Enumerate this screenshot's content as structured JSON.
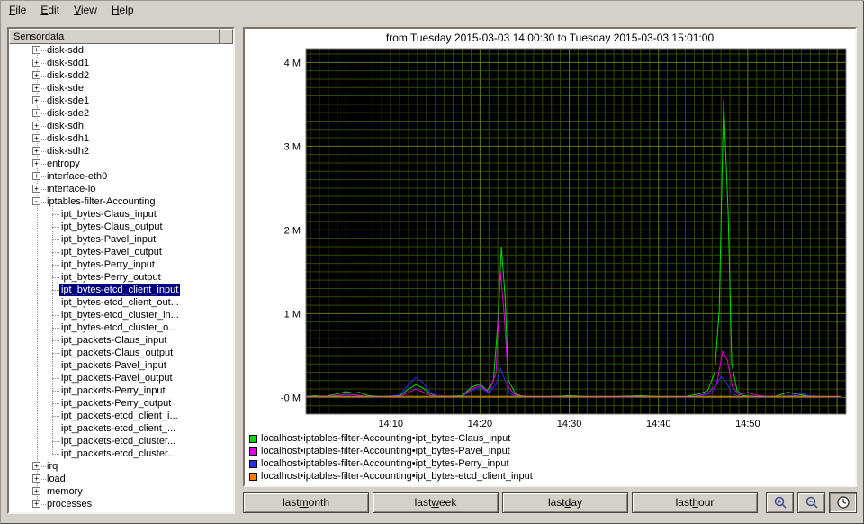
{
  "window": {
    "bg": "#d5d1c8"
  },
  "menu": {
    "items": [
      {
        "id": "file",
        "label": "File",
        "mnemonic": "F"
      },
      {
        "id": "edit",
        "label": "Edit",
        "mnemonic": "E"
      },
      {
        "id": "view",
        "label": "View",
        "mnemonic": "V"
      },
      {
        "id": "help",
        "label": "Help",
        "mnemonic": "H"
      }
    ]
  },
  "sidebar": {
    "header": "Sensordata",
    "items": [
      {
        "label": "disk-sdd",
        "level": 0,
        "expander": "plus",
        "selected": false
      },
      {
        "label": "disk-sdd1",
        "level": 0,
        "expander": "plus",
        "selected": false
      },
      {
        "label": "disk-sdd2",
        "level": 0,
        "expander": "plus",
        "selected": false
      },
      {
        "label": "disk-sde",
        "level": 0,
        "expander": "plus",
        "selected": false
      },
      {
        "label": "disk-sde1",
        "level": 0,
        "expander": "plus",
        "selected": false
      },
      {
        "label": "disk-sde2",
        "level": 0,
        "expander": "plus",
        "selected": false
      },
      {
        "label": "disk-sdh",
        "level": 0,
        "expander": "plus",
        "selected": false
      },
      {
        "label": "disk-sdh1",
        "level": 0,
        "expander": "plus",
        "selected": false
      },
      {
        "label": "disk-sdh2",
        "level": 0,
        "expander": "plus",
        "selected": false
      },
      {
        "label": "entropy",
        "level": 0,
        "expander": "plus",
        "selected": false
      },
      {
        "label": "interface-eth0",
        "level": 0,
        "expander": "plus",
        "selected": false
      },
      {
        "label": "interface-lo",
        "level": 0,
        "expander": "plus",
        "selected": false
      },
      {
        "label": "iptables-filter-Accounting",
        "level": 0,
        "expander": "minus",
        "selected": false
      },
      {
        "label": "ipt_bytes-Claus_input",
        "level": 1,
        "expander": null,
        "selected": false
      },
      {
        "label": "ipt_bytes-Claus_output",
        "level": 1,
        "expander": null,
        "selected": false
      },
      {
        "label": "ipt_bytes-Pavel_input",
        "level": 1,
        "expander": null,
        "selected": false
      },
      {
        "label": "ipt_bytes-Pavel_output",
        "level": 1,
        "expander": null,
        "selected": false
      },
      {
        "label": "ipt_bytes-Perry_input",
        "level": 1,
        "expander": null,
        "selected": false
      },
      {
        "label": "ipt_bytes-Perry_output",
        "level": 1,
        "expander": null,
        "selected": false
      },
      {
        "label": "ipt_bytes-etcd_client_input",
        "level": 1,
        "expander": null,
        "selected": true
      },
      {
        "label": "ipt_bytes-etcd_client_out...",
        "level": 1,
        "expander": null,
        "selected": false
      },
      {
        "label": "ipt_bytes-etcd_cluster_in...",
        "level": 1,
        "expander": null,
        "selected": false
      },
      {
        "label": "ipt_bytes-etcd_cluster_o...",
        "level": 1,
        "expander": null,
        "selected": false
      },
      {
        "label": "ipt_packets-Claus_input",
        "level": 1,
        "expander": null,
        "selected": false
      },
      {
        "label": "ipt_packets-Claus_output",
        "level": 1,
        "expander": null,
        "selected": false
      },
      {
        "label": "ipt_packets-Pavel_input",
        "level": 1,
        "expander": null,
        "selected": false
      },
      {
        "label": "ipt_packets-Pavel_output",
        "level": 1,
        "expander": null,
        "selected": false
      },
      {
        "label": "ipt_packets-Perry_input",
        "level": 1,
        "expander": null,
        "selected": false
      },
      {
        "label": "ipt_packets-Perry_output",
        "level": 1,
        "expander": null,
        "selected": false
      },
      {
        "label": "ipt_packets-etcd_client_i...",
        "level": 1,
        "expander": null,
        "selected": false
      },
      {
        "label": "ipt_packets-etcd_client_...",
        "level": 1,
        "expander": null,
        "selected": false
      },
      {
        "label": "ipt_packets-etcd_cluster...",
        "level": 1,
        "expander": null,
        "selected": false
      },
      {
        "label": "ipt_packets-etcd_cluster...",
        "level": 1,
        "expander": null,
        "selected": false
      },
      {
        "label": "irq",
        "level": 0,
        "expander": "plus",
        "selected": false
      },
      {
        "label": "load",
        "level": 0,
        "expander": "plus",
        "selected": false
      },
      {
        "label": "memory",
        "level": 0,
        "expander": "plus",
        "selected": false
      },
      {
        "label": "processes",
        "level": 0,
        "expander": "plus",
        "selected": false
      }
    ]
  },
  "chart_data": {
    "type": "line",
    "title": "from Tuesday 2015-03-03 14:00:30 to Tuesday 2015-03-03 15:01:00",
    "xlabel": "",
    "ylabel": "",
    "x_unit": "minutes after 14:00",
    "xlim": [
      0.5,
      61
    ],
    "ylim": [
      -0.2,
      4.165
    ],
    "x_ticks": [
      {
        "value": 10,
        "label": "14:10"
      },
      {
        "value": 20,
        "label": "14:20"
      },
      {
        "value": 30,
        "label": "14:30"
      },
      {
        "value": 40,
        "label": "14:40"
      },
      {
        "value": 50,
        "label": "14:50"
      }
    ],
    "y_ticks": [
      {
        "value": 4,
        "label": "4 M"
      },
      {
        "value": 3,
        "label": "3 M"
      },
      {
        "value": 2,
        "label": "2 M"
      },
      {
        "value": 1,
        "label": "1 M"
      },
      {
        "value": 0,
        "label": "-0 M"
      }
    ],
    "grid": {
      "background": "#000000",
      "minor_color": "#314a00",
      "major_color": "#5d7a16",
      "frame_color": "#7d7d7d",
      "minor_x_step": 1,
      "major_x_step": 10,
      "minor_y_step": 0.1,
      "major_y_step": 1
    },
    "legend_position": "bottom-left",
    "series": [
      {
        "name": "localhost•iptables-filter-Accounting•ipt_bytes-Claus_input",
        "color": "#00dc00",
        "points": [
          [
            0.5,
            0.01
          ],
          [
            1.5,
            0.02
          ],
          [
            2.5,
            0.01
          ],
          [
            4,
            0.04
          ],
          [
            5,
            0.07
          ],
          [
            5.8,
            0.05
          ],
          [
            6.5,
            0.06
          ],
          [
            7.5,
            0.02
          ],
          [
            9,
            0.01
          ],
          [
            11,
            0.02
          ],
          [
            12,
            0.1
          ],
          [
            12.8,
            0.15
          ],
          [
            13.5,
            0.12
          ],
          [
            14.5,
            0.04
          ],
          [
            15.5,
            0.01
          ],
          [
            18,
            0.02
          ],
          [
            19,
            0.12
          ],
          [
            20,
            0.16
          ],
          [
            20.8,
            0.08
          ],
          [
            21.5,
            0.2
          ],
          [
            22,
            0.9
          ],
          [
            22.4,
            1.8
          ],
          [
            22.8,
            1.2
          ],
          [
            23.2,
            0.2
          ],
          [
            24,
            0.04
          ],
          [
            25,
            0.01
          ],
          [
            28,
            0.01
          ],
          [
            30,
            0.02
          ],
          [
            32,
            0.01
          ],
          [
            35,
            0.01
          ],
          [
            38,
            0.02
          ],
          [
            40,
            0.01
          ],
          [
            43,
            0.01
          ],
          [
            44.5,
            0.04
          ],
          [
            45.5,
            0.08
          ],
          [
            46.3,
            0.3
          ],
          [
            46.8,
            1.05
          ],
          [
            47.3,
            3.55
          ],
          [
            47.8,
            2.2
          ],
          [
            48.2,
            0.4
          ],
          [
            48.8,
            0.08
          ],
          [
            49.5,
            0.02
          ],
          [
            51,
            0.01
          ],
          [
            53,
            0.01
          ],
          [
            54.5,
            0.06
          ],
          [
            55.5,
            0.04
          ],
          [
            56.5,
            0.02
          ],
          [
            58,
            0.01
          ],
          [
            60.5,
            0.01
          ]
        ]
      },
      {
        "name": "localhost•iptables-filter-Accounting•ipt_bytes-Pavel_input",
        "color": "#dc00dc",
        "points": [
          [
            0.5,
            0.005
          ],
          [
            4,
            0.02
          ],
          [
            5,
            0.04
          ],
          [
            6,
            0.03
          ],
          [
            7.5,
            0.01
          ],
          [
            11,
            0.01
          ],
          [
            12,
            0.06
          ],
          [
            12.8,
            0.1
          ],
          [
            13.5,
            0.07
          ],
          [
            14.5,
            0.02
          ],
          [
            18,
            0.01
          ],
          [
            19,
            0.1
          ],
          [
            20,
            0.14
          ],
          [
            21,
            0.06
          ],
          [
            21.8,
            0.3
          ],
          [
            22.3,
            1.5
          ],
          [
            22.7,
            1.0
          ],
          [
            23.2,
            0.12
          ],
          [
            24,
            0.02
          ],
          [
            26,
            0.01
          ],
          [
            30,
            0.01
          ],
          [
            35,
            0.005
          ],
          [
            40,
            0.01
          ],
          [
            44,
            0.01
          ],
          [
            45.5,
            0.05
          ],
          [
            46.5,
            0.15
          ],
          [
            47.2,
            0.55
          ],
          [
            47.7,
            0.45
          ],
          [
            48.3,
            0.12
          ],
          [
            49,
            0.03
          ],
          [
            50,
            0.06
          ],
          [
            50.8,
            0.03
          ],
          [
            52,
            0.01
          ],
          [
            55,
            0.02
          ],
          [
            57,
            0.01
          ],
          [
            60.5,
            0.005
          ]
        ]
      },
      {
        "name": "localhost•iptables-filter-Accounting•ipt_bytes-Perry_input",
        "color": "#2828ff",
        "points": [
          [
            0.5,
            0.005
          ],
          [
            4,
            0.01
          ],
          [
            5,
            0.02
          ],
          [
            6,
            0.01
          ],
          [
            9,
            0.005
          ],
          [
            11,
            0.03
          ],
          [
            12,
            0.15
          ],
          [
            12.8,
            0.24
          ],
          [
            13.6,
            0.18
          ],
          [
            14.5,
            0.05
          ],
          [
            15.5,
            0.01
          ],
          [
            18,
            0.01
          ],
          [
            19,
            0.08
          ],
          [
            20,
            0.12
          ],
          [
            21,
            0.05
          ],
          [
            21.8,
            0.15
          ],
          [
            22.3,
            0.35
          ],
          [
            22.8,
            0.2
          ],
          [
            23.3,
            0.05
          ],
          [
            24,
            0.01
          ],
          [
            28,
            0.005
          ],
          [
            32,
            0.01
          ],
          [
            36,
            0.005
          ],
          [
            40,
            0.01
          ],
          [
            44,
            0.005
          ],
          [
            46,
            0.05
          ],
          [
            47,
            0.25
          ],
          [
            47.6,
            0.18
          ],
          [
            48.2,
            0.05
          ],
          [
            49,
            0.01
          ],
          [
            52,
            0.005
          ],
          [
            55,
            0.02
          ],
          [
            56,
            0.05
          ],
          [
            56.8,
            0.02
          ],
          [
            58,
            0.01
          ],
          [
            60.5,
            0.005
          ]
        ]
      },
      {
        "name": "localhost•iptables-filter-Accounting•ipt_bytes-etcd_client_input",
        "color": "#ff8000",
        "points": [
          [
            0.5,
            0.012
          ],
          [
            10,
            0.012
          ],
          [
            20,
            0.012
          ],
          [
            30,
            0.012
          ],
          [
            40,
            0.012
          ],
          [
            50,
            0.012
          ],
          [
            60.5,
            0.012
          ]
        ]
      }
    ]
  },
  "controls": {
    "range_buttons": [
      {
        "id": "last-month",
        "label": "last month",
        "mnemonic": "m"
      },
      {
        "id": "last-week",
        "label": "last week",
        "mnemonic": "w"
      },
      {
        "id": "last-day",
        "label": "last day",
        "mnemonic": "d"
      },
      {
        "id": "last-hour",
        "label": "last hour",
        "mnemonic": "h"
      }
    ],
    "tool_buttons": [
      {
        "id": "zoom-in",
        "icon": "zoom-in-icon",
        "pressed": false
      },
      {
        "id": "zoom-out",
        "icon": "zoom-out-icon",
        "pressed": false
      },
      {
        "id": "auto-update",
        "icon": "auto-update-icon",
        "pressed": true
      }
    ]
  }
}
